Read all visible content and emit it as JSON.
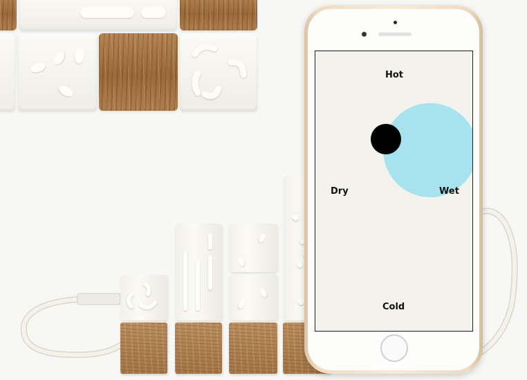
{
  "app": {
    "screen_labels": {
      "top": "Hot",
      "left": "Dry",
      "right": "Wet",
      "bottom": "Cold"
    }
  },
  "colors": {
    "wet_zone": "#a6e3ef",
    "marker": "#000000",
    "phone_frame": "#f0dcc4",
    "cable": "#f1efe7"
  }
}
